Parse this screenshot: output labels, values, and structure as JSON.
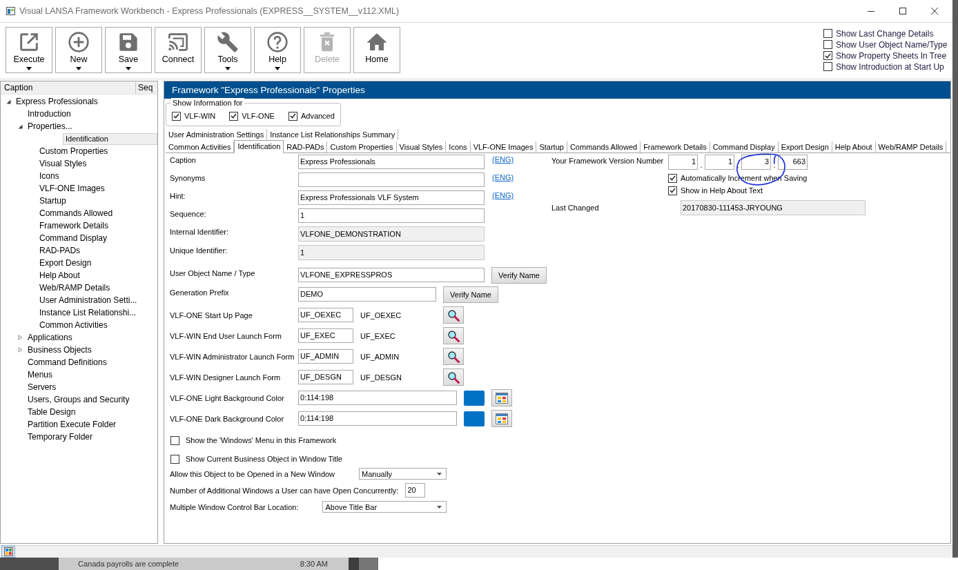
{
  "window": {
    "title": "Visual LANSA Framework Workbench - Express Professionals (EXPRESS__SYSTEM__v112.XML)"
  },
  "toolbar": {
    "buttons": [
      {
        "label": "Execute",
        "dropdown": true,
        "disabled": false
      },
      {
        "label": "New",
        "dropdown": true,
        "disabled": false
      },
      {
        "label": "Save",
        "dropdown": true,
        "disabled": false
      },
      {
        "label": "Connect",
        "dropdown": false,
        "disabled": false
      },
      {
        "label": "Tools",
        "dropdown": true,
        "disabled": false
      },
      {
        "label": "Help",
        "dropdown": true,
        "disabled": false
      },
      {
        "label": "Delete",
        "dropdown": false,
        "disabled": true
      },
      {
        "label": "Home",
        "dropdown": false,
        "disabled": false
      }
    ],
    "options": [
      {
        "label": "Show Last Change Details",
        "checked": false
      },
      {
        "label": "Show User Object Name/Type",
        "checked": false
      },
      {
        "label": "Show Property Sheets In Tree",
        "checked": true
      },
      {
        "label": "Show Introduction at Start Up",
        "checked": false
      }
    ]
  },
  "tree": {
    "columns": [
      "Caption",
      "Seq"
    ],
    "items": [
      {
        "label": "Express Professionals",
        "expanded": true,
        "selected": false,
        "children": [
          {
            "label": "Introduction",
            "selected": false
          },
          {
            "label": "Properties...",
            "expanded": true,
            "selected": false,
            "children": [
              {
                "label": "Identification",
                "selected": true
              },
              {
                "label": "Custom Properties",
                "selected": false
              },
              {
                "label": "Visual Styles",
                "selected": false
              },
              {
                "label": "Icons",
                "selected": false
              },
              {
                "label": "VLF-ONE Images",
                "selected": false
              },
              {
                "label": "Startup",
                "selected": false
              },
              {
                "label": "Commands Allowed",
                "selected": false
              },
              {
                "label": "Framework Details",
                "selected": false
              },
              {
                "label": "Command Display",
                "selected": false
              },
              {
                "label": "RAD-PADs",
                "selected": false
              },
              {
                "label": "Export Design",
                "selected": false
              },
              {
                "label": "Help About",
                "selected": false
              },
              {
                "label": "Web/RAMP Details",
                "selected": false
              },
              {
                "label": "User Administration Setti...",
                "selected": false
              },
              {
                "label": "Instance List Relationshi...",
                "selected": false
              },
              {
                "label": "Common Activities",
                "selected": false
              }
            ]
          },
          {
            "label": "Applications",
            "expanded": false,
            "selected": false
          },
          {
            "label": "Business Objects",
            "expanded": false,
            "selected": false
          },
          {
            "label": "Command Definitions",
            "selected": false
          },
          {
            "label": "Menus",
            "selected": false
          },
          {
            "label": "Servers",
            "selected": false
          },
          {
            "label": "Users, Groups and Security",
            "selected": false
          },
          {
            "label": "Table Design",
            "selected": false
          },
          {
            "label": "Partition Execute Folder",
            "selected": false
          },
          {
            "label": "Temporary Folder",
            "selected": false
          }
        ]
      }
    ]
  },
  "panel": {
    "title": "Framework \"Express Professionals\" Properties",
    "show_information": {
      "legend": "Show Information for",
      "options": [
        {
          "label": "VLF-WIN",
          "checked": true
        },
        {
          "label": "VLF-ONE",
          "checked": true
        },
        {
          "label": "Advanced",
          "checked": true
        }
      ]
    },
    "tab_rows": [
      {
        "tabs": [
          {
            "label": "User Administration Settings",
            "selected": false
          },
          {
            "label": "Instance List Relationships Summary",
            "selected": false
          }
        ]
      },
      {
        "tabs": [
          {
            "label": "Common Activities",
            "selected": false
          },
          {
            "label": "Identification",
            "selected": true
          },
          {
            "label": "RAD-PADs",
            "selected": false
          },
          {
            "label": "Custom Properties",
            "selected": false
          },
          {
            "label": "Visual Styles",
            "selected": false
          },
          {
            "label": "Icons",
            "selected": false
          },
          {
            "label": "VLF-ONE Images",
            "selected": false
          },
          {
            "label": "Startup",
            "selected": false
          },
          {
            "label": "Commands Allowed",
            "selected": false
          },
          {
            "label": "Framework Details",
            "selected": false
          },
          {
            "label": "Command Display",
            "selected": false
          },
          {
            "label": "Export Design",
            "selected": false
          },
          {
            "label": "Help About",
            "selected": false
          },
          {
            "label": "Web/RAMP Details",
            "selected": false
          }
        ]
      }
    ],
    "fields": [
      {
        "kind": "text",
        "label": "Caption",
        "value": "Express Professionals",
        "link": "(ENG)",
        "disabled": false
      },
      {
        "kind": "text",
        "label": "Synonyms",
        "link": "(ENG)",
        "disabled": false
      },
      {
        "kind": "text",
        "label": "Hint:",
        "value": "Express Professionals VLF System",
        "link": "(ENG)",
        "disabled": false
      },
      {
        "kind": "text",
        "label": "Sequence:",
        "value": "1",
        "disabled": false
      },
      {
        "kind": "text",
        "label": "Internal Identifier:",
        "value": "VLFONE_DEMONSTRATION",
        "disabled": true
      },
      {
        "kind": "text",
        "label": "Unique Identifier:",
        "value": "1",
        "disabled": true
      },
      {
        "kind": "text",
        "label": "User Object Name / Type",
        "value": "VLFONE_EXPRESSPROS",
        "button": "Verify Name",
        "disabled": false
      },
      {
        "kind": "short",
        "label": "Generation Prefix",
        "value": "DEMO",
        "button": "Verify Name",
        "disabled": false
      },
      {
        "kind": "lookup",
        "label": "VLF-ONE Start Up Page",
        "value": "UF_OEXEC",
        "resolved": "UF_OEXEC"
      },
      {
        "kind": "lookup",
        "label": "VLF-WIN End User Launch Form",
        "value": "UF_EXEC",
        "resolved": "UF_EXEC"
      },
      {
        "kind": "lookup",
        "label": "VLF-WIN Administrator Launch Form",
        "value": "UF_ADMIN",
        "resolved": "UF_ADMIN"
      },
      {
        "kind": "lookup",
        "label": "VLF-WIN Designer Launch Form",
        "value": "UF_DESGN",
        "resolved": "UF_DESGN"
      },
      {
        "kind": "color",
        "label": "VLF-ONE Light Background Color",
        "value": "0:114:198",
        "color": "#0072c6"
      },
      {
        "kind": "color",
        "label": "VLF-ONE Dark Background Color",
        "value": "0:114:198",
        "color": "#0072c6"
      },
      {
        "kind": "checkbox",
        "label": "Show the 'Windows' Menu in this Framework",
        "checked": false
      },
      {
        "kind": "checkbox",
        "label": "Show Current Business Object in Window Title",
        "checked": false
      },
      {
        "kind": "select",
        "label": "Allow this Object to be Opened in a New Window",
        "value": "Manually"
      },
      {
        "kind": "number",
        "label": "Number of Additional Windows a User can have Open Concurrently:",
        "value": "20"
      },
      {
        "kind": "select",
        "label": "Multiple Window Control Bar Location:",
        "value": "Above Title Bar"
      }
    ],
    "version": {
      "label": "Your Framework Version Number",
      "parts": [
        {
          "value": "1",
          "separator": "."
        },
        {
          "value": "1",
          "separator": "."
        },
        {
          "value": "3",
          "separator": "."
        },
        {
          "value": "663"
        }
      ],
      "options": [
        {
          "label": "Automatically Increment when Saving",
          "checked": true
        },
        {
          "label": "Show in Help About Text",
          "checked": true
        }
      ],
      "last_changed": {
        "label": "Last Changed",
        "value": "20170830-111453-JRYOUNG"
      }
    }
  },
  "background_window": {
    "text": "Canada payrolls are complete",
    "time": "8:30 AM"
  }
}
